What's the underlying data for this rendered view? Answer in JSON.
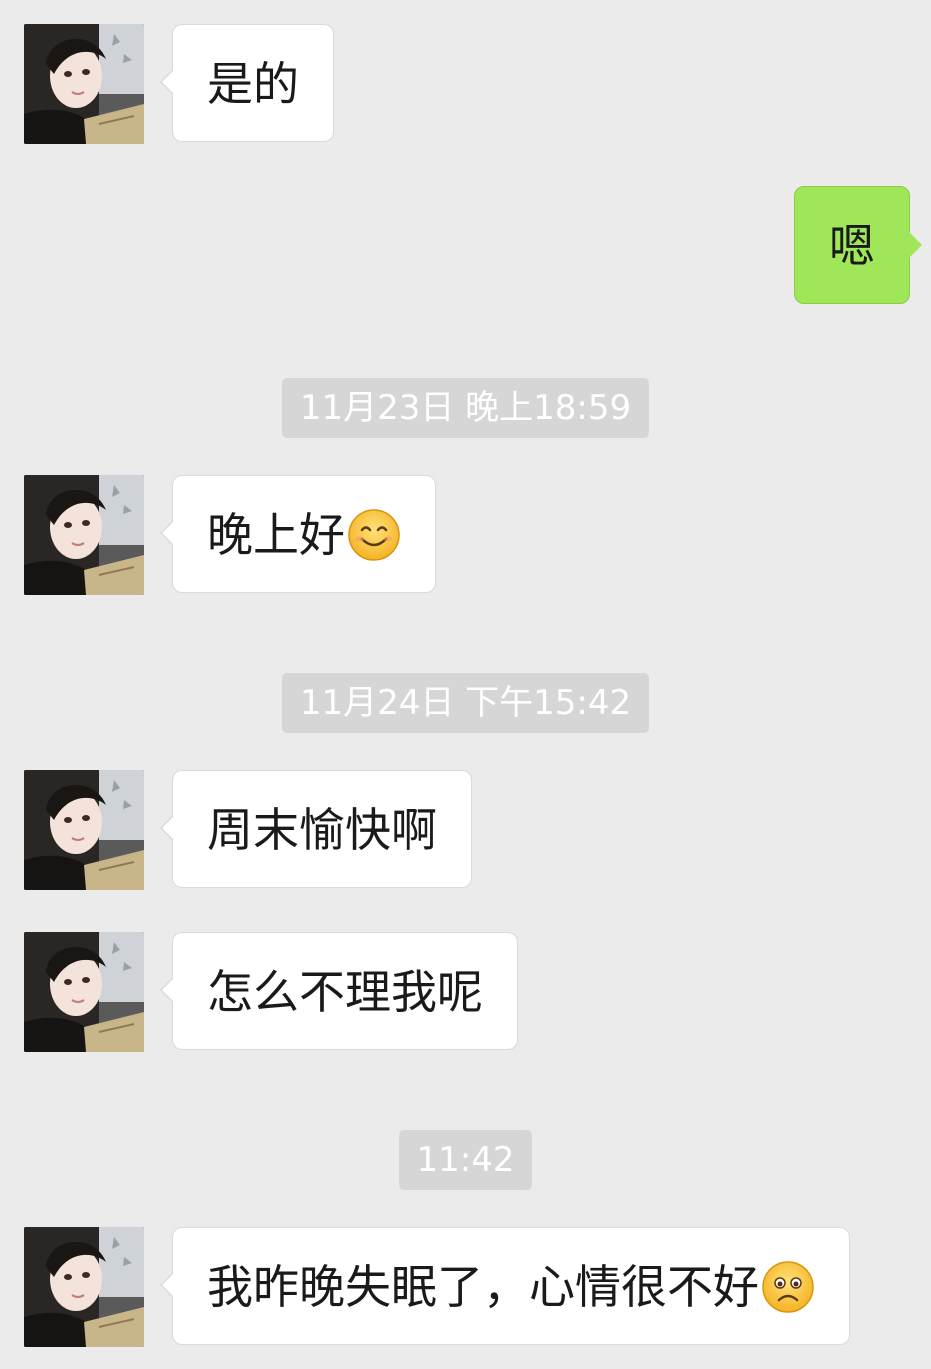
{
  "conversation": {
    "messages": [
      {
        "sender": "contact",
        "text": "是的"
      },
      {
        "sender": "me",
        "text": "嗯"
      },
      {
        "sender": "contact",
        "text": "晚上好",
        "emoji": "smile-emoji"
      },
      {
        "sender": "contact",
        "text": "周末愉快啊"
      },
      {
        "sender": "contact",
        "text": "怎么不理我呢"
      },
      {
        "sender": "contact",
        "text": "我昨晚失眠了，心情很不好",
        "emoji": "sad-emoji"
      }
    ],
    "timestamps": [
      "11月23日 晚上18:59",
      "11月24日 下午15:42",
      "11:42"
    ]
  },
  "colors": {
    "background": "#ebebeb",
    "incoming_bubble": "#ffffff",
    "outgoing_bubble": "#9fe658",
    "timestamp_bg": "#d6d6d6",
    "timestamp_text": "#ffffff"
  },
  "avatar": {
    "icon": "contact-avatar"
  }
}
